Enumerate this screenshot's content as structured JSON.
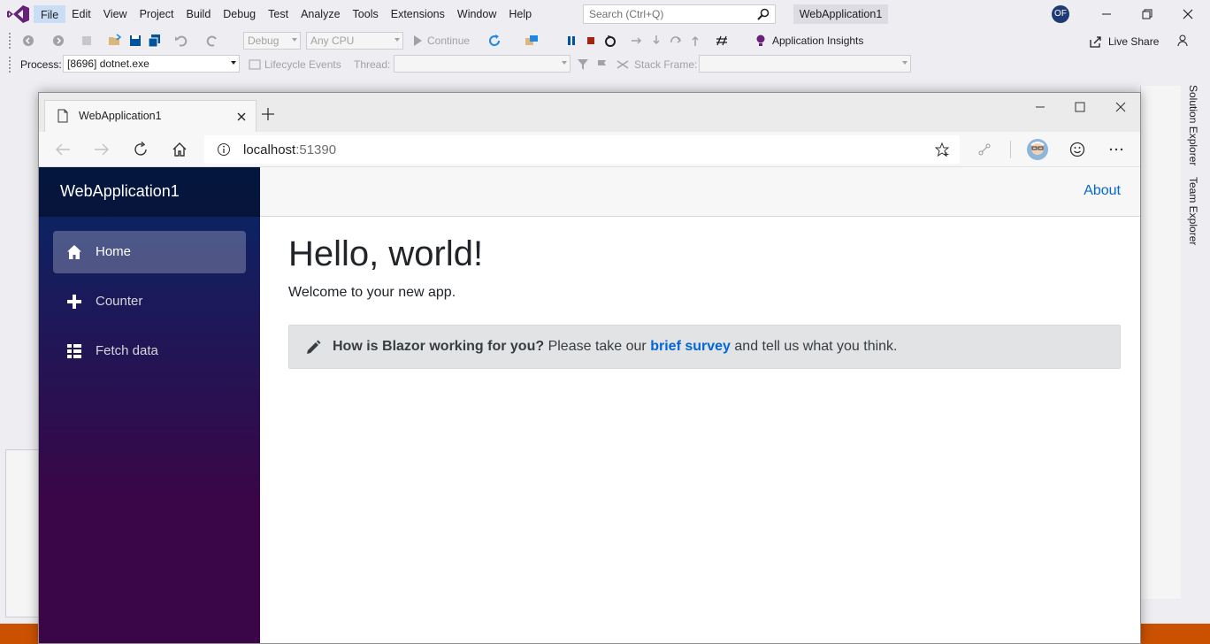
{
  "vs": {
    "menu": [
      "File",
      "Edit",
      "View",
      "Project",
      "Build",
      "Debug",
      "Test",
      "Analyze",
      "Tools",
      "Extensions",
      "Window",
      "Help"
    ],
    "search_placeholder": "Search (Ctrl+Q)",
    "solution_name": "WebApplication1",
    "user_initials": "OF",
    "toolbar": {
      "config": "Debug",
      "platform": "Any CPU",
      "continue": "Continue",
      "app_insights": "Application Insights",
      "live_share": "Live Share"
    },
    "debug_location": {
      "process_label": "Process:",
      "process_value": "[8696] dotnet.exe",
      "lifecycle_events": "Lifecycle Events",
      "thread_label": "Thread:",
      "stack_frame_label": "Stack Frame:"
    },
    "side_tabs": [
      "Solution Explorer",
      "Team Explorer"
    ]
  },
  "browser": {
    "tab_title": "WebApplication1",
    "url_host": "localhost",
    "url_port": ":51390"
  },
  "app": {
    "brand": "WebApplication1",
    "nav": [
      {
        "label": "Home",
        "icon": "home-icon",
        "active": true
      },
      {
        "label": "Counter",
        "icon": "plus-icon",
        "active": false
      },
      {
        "label": "Fetch data",
        "icon": "list-icon",
        "active": false
      }
    ],
    "top_link": "About",
    "heading": "Hello, world!",
    "welcome": "Welcome to your new app.",
    "survey": {
      "question": "How is Blazor working for you?",
      "prefix": "Please take our",
      "link_text": "brief survey",
      "suffix": "and tell us what you think."
    }
  },
  "colors": {
    "vs_chrome": "#eeeef2",
    "vs_accent": "#68217a",
    "sidebar_top": "#052767",
    "sidebar_bottom": "#3a0647",
    "link": "#0366d6",
    "alert_bg": "#e2e3e5",
    "statusbar": "#ca5100"
  }
}
